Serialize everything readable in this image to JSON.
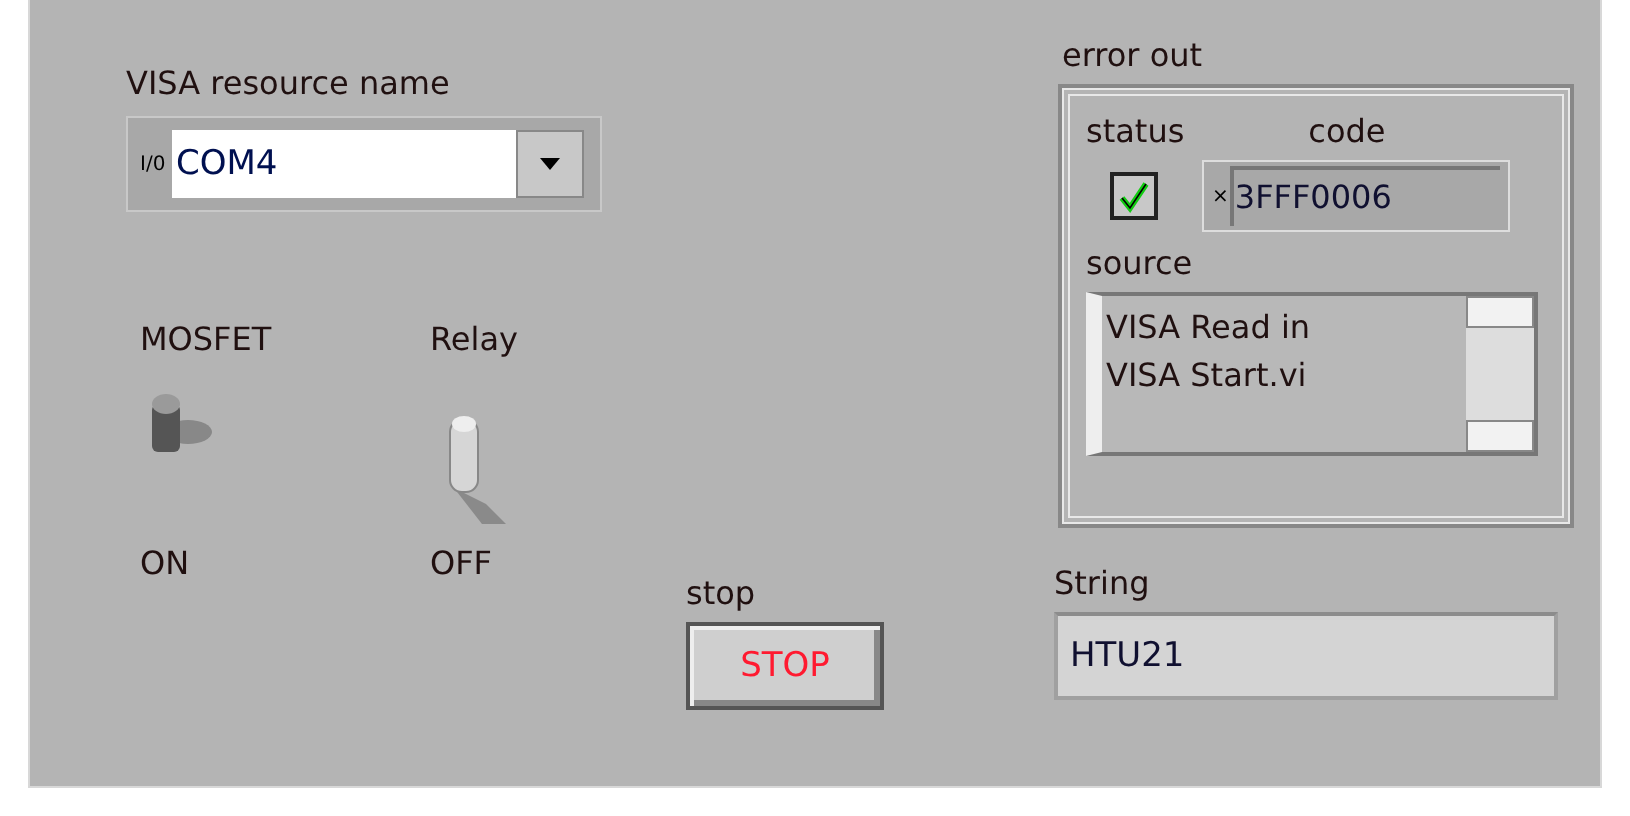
{
  "visa": {
    "label": "VISA resource name",
    "io_glyph": "I/0",
    "value": "COM4"
  },
  "switches": [
    {
      "label": "MOSFET",
      "on": true,
      "state_text": "ON"
    },
    {
      "label": "Relay",
      "on": false,
      "state_text": "OFF"
    }
  ],
  "stop": {
    "label": "stop",
    "button": "STOP"
  },
  "error_out": {
    "label": "error out",
    "status_label": "status",
    "status": true,
    "code_label": "code",
    "code_prefix": "×",
    "code": "3FFF0006",
    "source_label": "source",
    "source": "VISA Read in\nVISA Start.vi"
  },
  "string": {
    "label": "String",
    "value": "HTU21"
  }
}
